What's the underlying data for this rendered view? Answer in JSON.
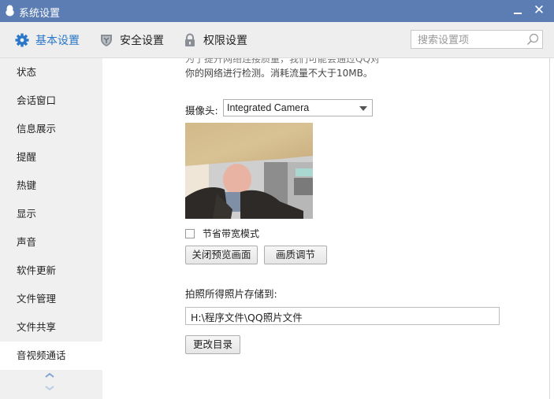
{
  "window": {
    "title": "系统设置",
    "icons": {
      "logo": "qq-penguin-icon",
      "minimize": "minimize-icon",
      "close": "close-icon"
    },
    "close_glyph": "✕"
  },
  "toolbar": {
    "tabs": [
      {
        "label": "基本设置",
        "icon": "gear-icon",
        "active": true
      },
      {
        "label": "安全设置",
        "icon": "shield-icon",
        "active": false
      },
      {
        "label": "权限设置",
        "icon": "lock-icon",
        "active": false
      }
    ],
    "search": {
      "placeholder": "搜索设置项",
      "value": "",
      "icon": "search-icon"
    }
  },
  "sidebar": {
    "items": [
      {
        "label": "状态"
      },
      {
        "label": "会话窗口"
      },
      {
        "label": "信息展示"
      },
      {
        "label": "提醒"
      },
      {
        "label": "热键"
      },
      {
        "label": "显示"
      },
      {
        "label": "声音"
      },
      {
        "label": "软件更新"
      },
      {
        "label": "文件管理"
      },
      {
        "label": "文件共享"
      },
      {
        "label": "音视频通话",
        "active": true
      }
    ],
    "scroll_up_icon": "chevron-up-icon",
    "scroll_down_icon": "chevron-down-icon"
  },
  "content": {
    "description_line1": "为了提升网络连接质量，我们可能会通过QQ对",
    "description_line2": "你的网络进行检测。消耗流量不大于10MB。",
    "camera_label": "摄像头:",
    "camera_selected": "Integrated Camera",
    "bandwidth_checkbox_label": "节省带宽模式",
    "bandwidth_checked": false,
    "close_preview_button": "关闭预览画面",
    "quality_button": "画质调节",
    "photo_save_label": "拍照所得照片存储到:",
    "photo_save_path": "H:\\程序文件\\QQ照片文件",
    "change_dir_button": "更改目录"
  },
  "colors": {
    "titlebar": "#5b7db3",
    "accent": "#2a76c8",
    "toolbar_bg": "#eeeeee",
    "sidebar_bg": "#f0f0f0"
  }
}
